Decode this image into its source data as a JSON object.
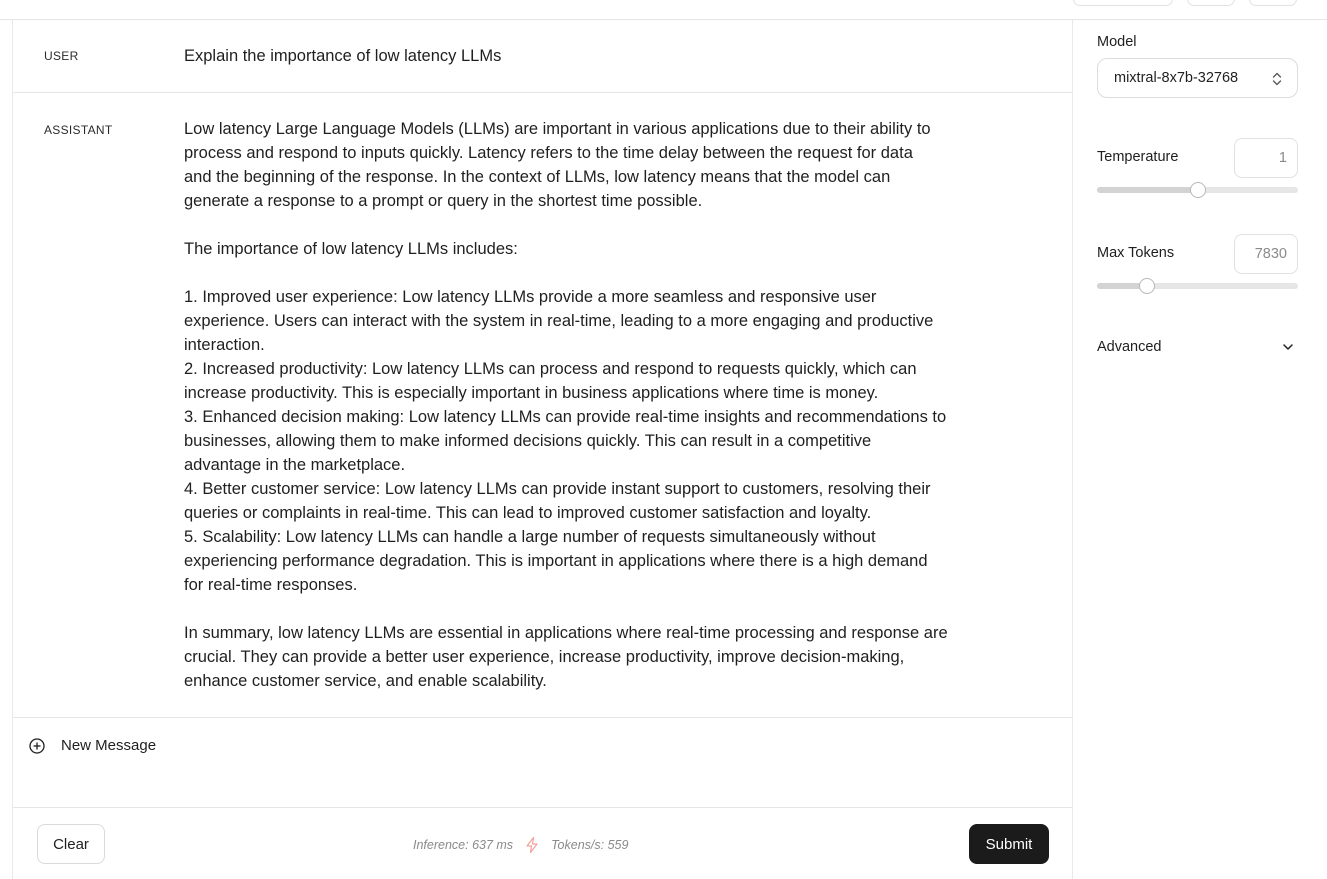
{
  "chat": {
    "messages": [
      {
        "role": "USER",
        "text": "Explain the importance of low latency LLMs"
      },
      {
        "role": "ASSISTANT",
        "text": "Low latency Large Language Models (LLMs) are important in various applications due to their ability to\nprocess and respond to inputs quickly. Latency refers to the time delay between the request for data\nand the beginning of the response. In the context of LLMs, low latency means that the model can\ngenerate a response to a prompt or query in the shortest time possible.\n\nThe importance of low latency LLMs includes:\n\n1. Improved user experience: Low latency LLMs provide a more seamless and responsive user\nexperience. Users can interact with the system in real-time, leading to a more engaging and productive\ninteraction.\n2. Increased productivity: Low latency LLMs can process and respond to requests quickly, which can\nincrease productivity. This is especially important in business applications where time is money.\n3. Enhanced decision making: Low latency LLMs can provide real-time insights and recommendations to\nbusinesses, allowing them to make informed decisions quickly. This can result in a competitive\nadvantage in the marketplace.\n4. Better customer service: Low latency LLMs can provide instant support to customers, resolving their\nqueries or complaints in real-time. This can lead to improved customer satisfaction and loyalty.\n5. Scalability: Low latency LLMs can handle a large number of requests simultaneously without\nexperiencing performance degradation. This is important in applications where there is a high demand\nfor real-time responses.\n\nIn summary, low latency LLMs are essential in applications where real-time processing and response are\ncrucial. They can provide a better user experience, increase productivity, improve decision-making,\nenhance customer service, and enable scalability."
      }
    ],
    "new_message_label": "New Message"
  },
  "footer": {
    "clear_label": "Clear",
    "inference_text": "Inference: 637 ms",
    "tokens_text": "Tokens/s: 559",
    "submit_label": "Submit",
    "bolt_color": "#f2a39c"
  },
  "sidebar": {
    "model_label": "Model",
    "model_value": "mixtral-8x7b-32768",
    "temperature_label": "Temperature",
    "temperature_value": "1",
    "temperature_fraction": 0.5,
    "max_tokens_label": "Max Tokens",
    "max_tokens_value": "7830",
    "max_tokens_fraction": 0.25,
    "advanced_label": "Advanced"
  }
}
